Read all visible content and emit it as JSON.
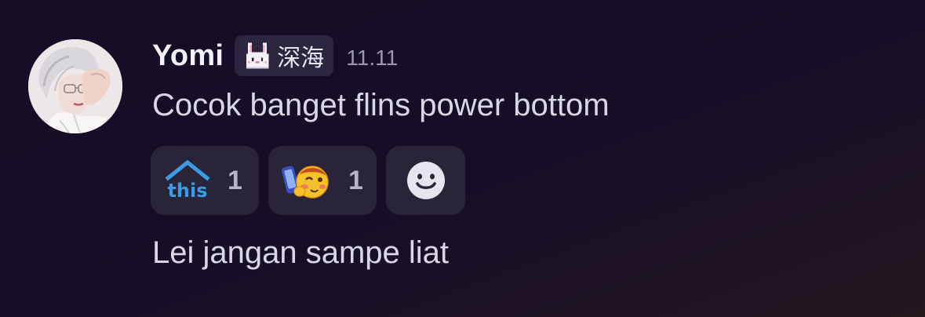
{
  "message": {
    "author": "Yomi",
    "tag": {
      "icon": "bunny-pixel-icon",
      "label": "深海"
    },
    "timestamp": "11.11",
    "lines": [
      "Cocok banget flins power bottom",
      "Lei jangan sampe liat"
    ],
    "reactions": [
      {
        "emoji": "this-emoji",
        "count": "1"
      },
      {
        "emoji": "blushing-face-phone-emoji",
        "count": "1"
      }
    ],
    "add_reaction_icon": "smiley-add-reaction-icon"
  },
  "colors": {
    "background": "#170f29",
    "pill": "#2a2439",
    "text": "#d9d7e6",
    "username": "#f2f1f8",
    "timestamp": "#9a97ad",
    "this_blue": "#3b9be6"
  }
}
